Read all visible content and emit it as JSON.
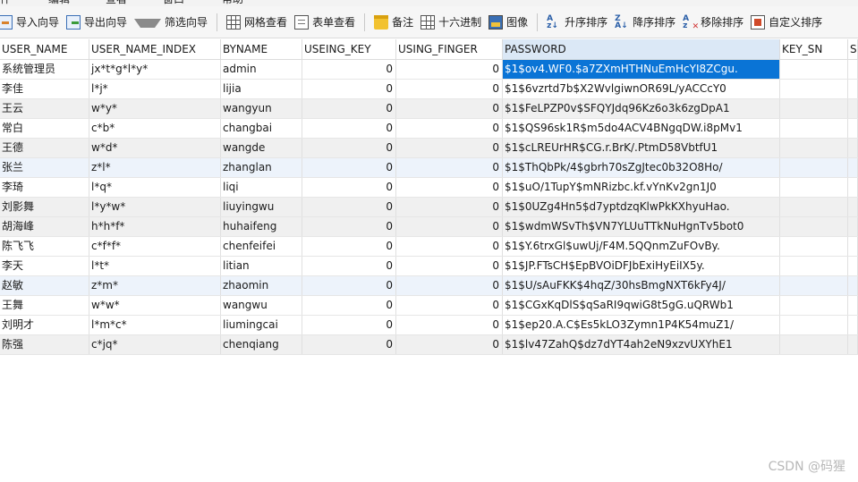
{
  "menu": [
    "件",
    "编辑",
    "查看",
    "窗口",
    "帮助"
  ],
  "toolbar": {
    "import_wizard": "导入向导",
    "export_wizard": "导出向导",
    "filter_wizard": "筛选向导",
    "grid_view": "网格查看",
    "form_view": "表单查看",
    "note": "备注",
    "hex": "十六进制",
    "image": "图像",
    "sort_asc": "升序排序",
    "sort_desc": "降序排序",
    "remove_sort": "移除排序",
    "custom_sort": "自定义排序"
  },
  "columns": [
    "USER_NAME",
    "USER_NAME_INDEX",
    "BYNAME",
    "USEING_KEY",
    "USING_FINGER",
    "PASSWORD",
    "KEY_SN",
    "SE"
  ],
  "rows": [
    {
      "user_name": "系统管理员",
      "index": "jx*t*g*l*y*",
      "byname": "admin",
      "key": "0",
      "finger": "0",
      "password": "$1$ov4.WF0.$a7ZXmHTHNuEmHcYI8ZCgu."
    },
    {
      "user_name": "李佳",
      "index": "l*j*",
      "byname": "lijia",
      "key": "0",
      "finger": "0",
      "password": "$1$6vzrtd7b$X2WvlgiwnOR69L/yACCcY0"
    },
    {
      "user_name": "王云",
      "index": "w*y*",
      "byname": "wangyun",
      "key": "0",
      "finger": "0",
      "password": "$1$FeLPZP0v$SFQYJdq96Kz6o3k6zgDpA1"
    },
    {
      "user_name": "常白",
      "index": "c*b*",
      "byname": "changbai",
      "key": "0",
      "finger": "0",
      "password": "$1$QS96sk1R$m5do4ACV4BNgqDW.i8pMv1"
    },
    {
      "user_name": "王德",
      "index": "w*d*",
      "byname": "wangde",
      "key": "0",
      "finger": "0",
      "password": "$1$cLREUrHR$CG.r.BrK/.PtmD58VbtfU1"
    },
    {
      "user_name": "张兰",
      "index": "z*l*",
      "byname": "zhanglan",
      "key": "0",
      "finger": "0",
      "password": "$1$ThQbPk/4$gbrh70sZgJtec0b32O8Ho/"
    },
    {
      "user_name": "李琦",
      "index": "l*q*",
      "byname": "liqi",
      "key": "0",
      "finger": "0",
      "password": "$1$uO/1TupY$mNRizbc.kf.vYnKv2gn1J0"
    },
    {
      "user_name": "刘影舞",
      "index": "l*y*w*",
      "byname": "liuyingwu",
      "key": "0",
      "finger": "0",
      "password": "$1$0UZg4Hn5$d7yptdzqKlwPkKXhyuHao."
    },
    {
      "user_name": "胡海峰",
      "index": "h*h*f*",
      "byname": "huhaifeng",
      "key": "0",
      "finger": "0",
      "password": "$1$wdmWSvTh$VN7YLUuTTkNuHgnTv5bot0"
    },
    {
      "user_name": "陈飞飞",
      "index": "c*f*f*",
      "byname": "chenfeifei",
      "key": "0",
      "finger": "0",
      "password": "$1$Y.6trxGl$uwUj/F4M.5QQnmZuFOvBy."
    },
    {
      "user_name": "李天",
      "index": "l*t*",
      "byname": "litian",
      "key": "0",
      "finger": "0",
      "password": "$1$JP.FTsCH$EpBVOiDFJbExiHyEiIX5y."
    },
    {
      "user_name": "赵敏",
      "index": "z*m*",
      "byname": "zhaomin",
      "key": "0",
      "finger": "0",
      "password": "$1$U/sAuFKK$4hqZ/30hsBmgNXT6kFy4J/"
    },
    {
      "user_name": "王舞",
      "index": "w*w*",
      "byname": "wangwu",
      "key": "0",
      "finger": "0",
      "password": "$1$CGxKqDlS$qSaRI9qwiG8t5gG.uQRWb1"
    },
    {
      "user_name": "刘明才",
      "index": "l*m*c*",
      "byname": "liumingcai",
      "key": "0",
      "finger": "0",
      "password": "$1$ep20.A.C$Es5kLO3Zymn1P4K54muZ1/"
    },
    {
      "user_name": "陈强",
      "index": "c*jq*",
      "byname": "chenqiang",
      "key": "0",
      "finger": "0",
      "password": "$1$lv47ZahQ$dz7dYT4ah2eN9xzvUXYhE1"
    }
  ],
  "row_styles": [
    "",
    "",
    "alt",
    "",
    "alt",
    "hl",
    "",
    "alt",
    "alt",
    "",
    "",
    "hl",
    "",
    "",
    "alt"
  ],
  "watermark": "CSDN @码猩"
}
